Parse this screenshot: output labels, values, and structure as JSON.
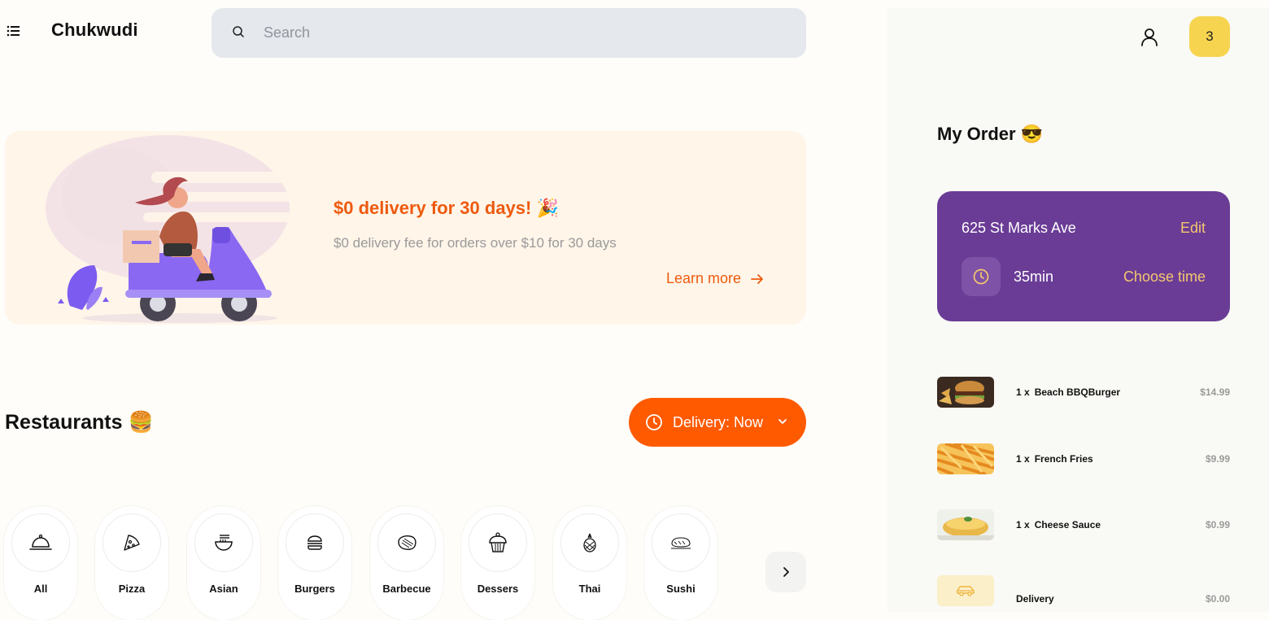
{
  "header": {
    "brand": "Chukwudi",
    "search_placeholder": "Search"
  },
  "promo": {
    "title": "$0 delivery for 30 days! 🎉",
    "subtitle": "$0 delivery fee for orders over $10 for 30 days",
    "link": "Learn more"
  },
  "restaurants": {
    "title": "Restaurants 🍔",
    "delivery_button": "Delivery: Now"
  },
  "categories": [
    {
      "label": "All",
      "icon": "cloche-icon"
    },
    {
      "label": "Pizza",
      "icon": "pizza-icon"
    },
    {
      "label": "Asian",
      "icon": "noodle-bowl-icon"
    },
    {
      "label": "Burgers",
      "icon": "burger-icon"
    },
    {
      "label": "Barbecue",
      "icon": "steak-icon"
    },
    {
      "label": "Dessers",
      "icon": "cupcake-icon"
    },
    {
      "label": "Thai",
      "icon": "pineapple-icon"
    },
    {
      "label": "Sushi",
      "icon": "sushi-icon"
    }
  ],
  "sidebar": {
    "cart_count": "3",
    "order_title": "My Order 😎",
    "address": "625 St Marks Ave",
    "edit_label": "Edit",
    "eta": "35min",
    "choose_time": "Choose time",
    "items": [
      {
        "qty": "1 x",
        "name": "Beach BBQBurger",
        "price": "$14.99"
      },
      {
        "qty": "1 x",
        "name": "French Fries",
        "price": "$9.99"
      },
      {
        "qty": "1 x",
        "name": "Cheese Sauce",
        "price": "$0.99"
      }
    ],
    "delivery": {
      "name": "Delivery",
      "price": "$0.00"
    }
  },
  "colors": {
    "accent_orange": "#ff5a00",
    "card_purple": "#6a3c96",
    "badge_yellow": "#f7d450",
    "search_bg": "#e5e8ec"
  }
}
